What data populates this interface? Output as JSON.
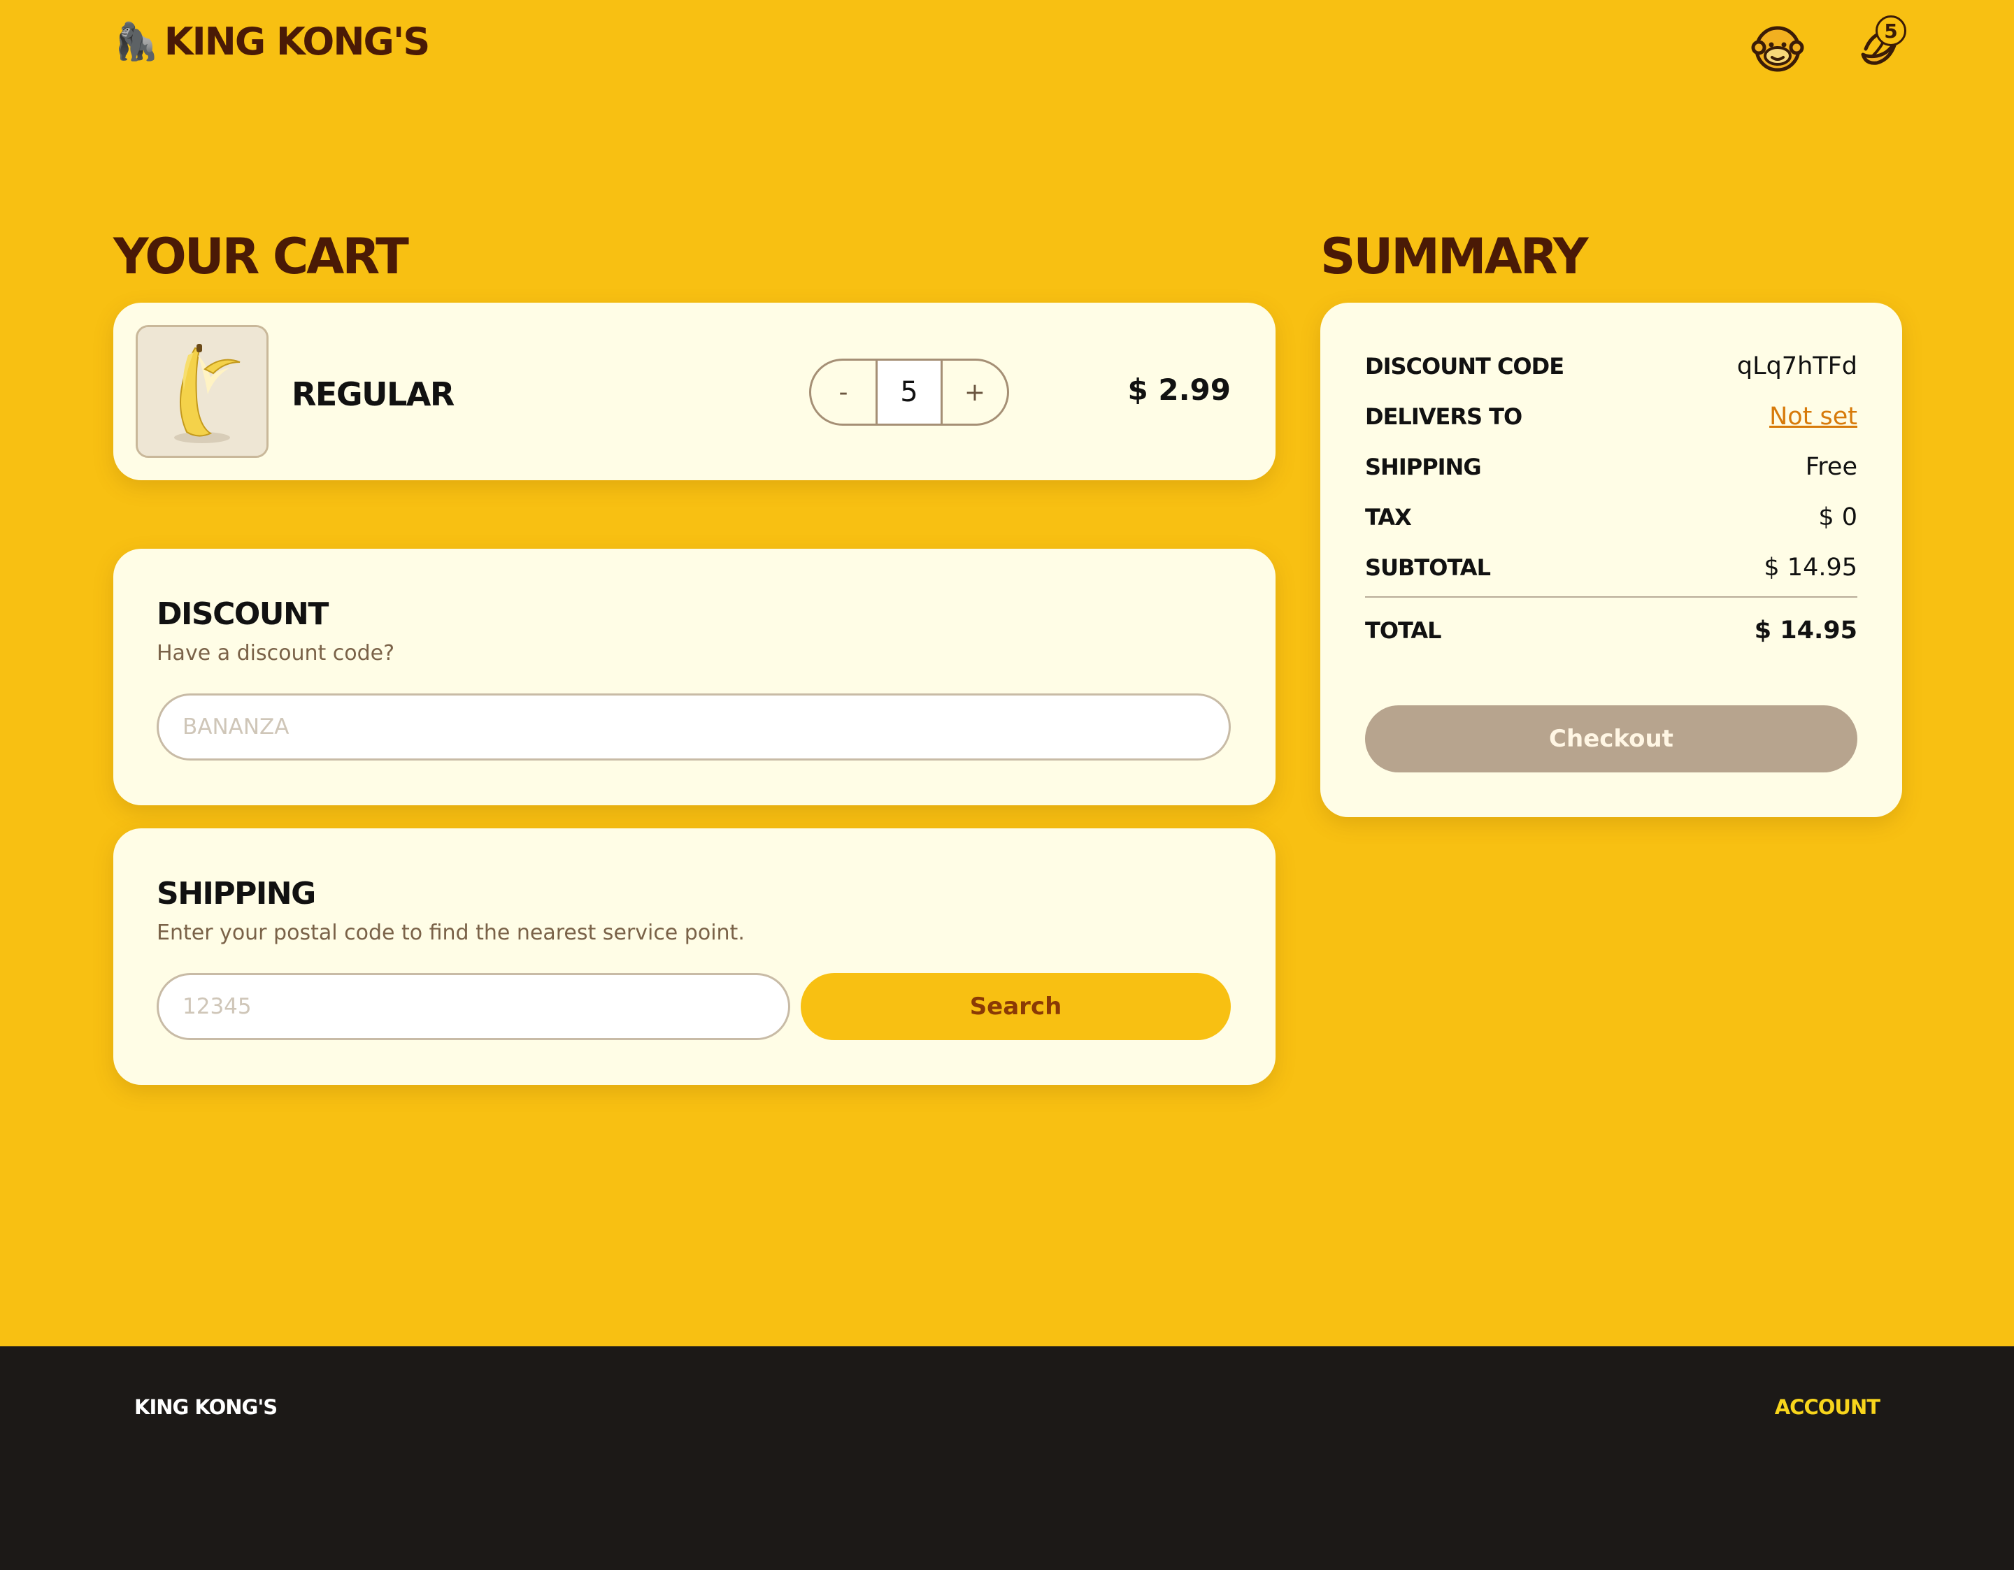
{
  "header": {
    "brand": "KING KONG'S",
    "brand_icon": "gorilla-emoji",
    "account_icon": "monkey-face-icon",
    "cart_icon": "banana-icon",
    "cart_count": "5"
  },
  "cart": {
    "title": "YOUR CART",
    "items": [
      {
        "name": "REGULAR",
        "quantity": "5",
        "price": "$ 2.99",
        "decrement": "-",
        "increment": "+"
      }
    ]
  },
  "discount": {
    "title": "DISCOUNT",
    "subtitle": "Have a discount code?",
    "placeholder": "BANANZA"
  },
  "shipping": {
    "title": "SHIPPING",
    "subtitle": "Enter your postal code to find the nearest service point.",
    "placeholder": "12345",
    "search_label": "Search"
  },
  "summary": {
    "title": "SUMMARY",
    "rows": [
      {
        "label": "DISCOUNT CODE",
        "value": "qLq7hTFd"
      },
      {
        "label": "DELIVERS TO",
        "value": "Not set"
      },
      {
        "label": "SHIPPING",
        "value": "Free"
      },
      {
        "label": "TAX",
        "value": "$ 0"
      },
      {
        "label": "SUBTOTAL",
        "value": "$ 14.95"
      }
    ],
    "total_label": "TOTAL",
    "total_value": "$ 14.95",
    "checkout_label": "Checkout"
  },
  "footer": {
    "brand": "KING KONG'S",
    "account_link": "ACCOUNT"
  },
  "colors": {
    "background": "#F8C012",
    "brand_dark": "#4A1A06",
    "card": "#FFFDE6",
    "footer": "#1C1917",
    "link": "#D77A0A",
    "checkout_disabled": "#B7A48E"
  }
}
